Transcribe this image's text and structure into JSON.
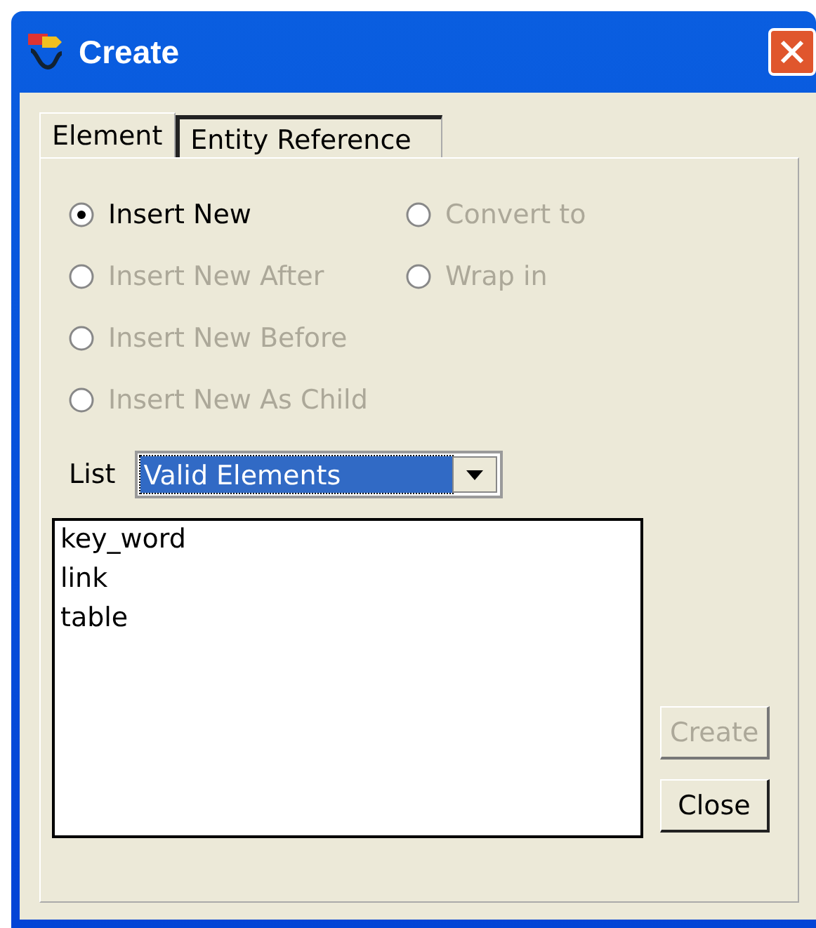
{
  "window": {
    "title": "Create"
  },
  "tabs": [
    {
      "label": "Element",
      "selected": true
    },
    {
      "label": "Entity Reference",
      "selected": false
    }
  ],
  "options": [
    {
      "label": "Insert New",
      "selected": true,
      "disabled": false
    },
    {
      "label": "Insert New After",
      "selected": false,
      "disabled": true
    },
    {
      "label": "Insert New Before",
      "selected": false,
      "disabled": true
    },
    {
      "label": "Insert New As Child",
      "selected": false,
      "disabled": true
    },
    {
      "label": "Convert to",
      "selected": false,
      "disabled": true
    },
    {
      "label": "Wrap in",
      "selected": false,
      "disabled": true
    }
  ],
  "list_selector": {
    "label": "List",
    "value": "Valid Elements"
  },
  "items": [
    {
      "label": "key_word",
      "selected": false
    },
    {
      "label": "link",
      "selected": false
    },
    {
      "label": "table",
      "selected": false
    }
  ],
  "buttons": [
    {
      "label": "Create",
      "disabled": true
    },
    {
      "label": "Close",
      "disabled": false
    }
  ]
}
